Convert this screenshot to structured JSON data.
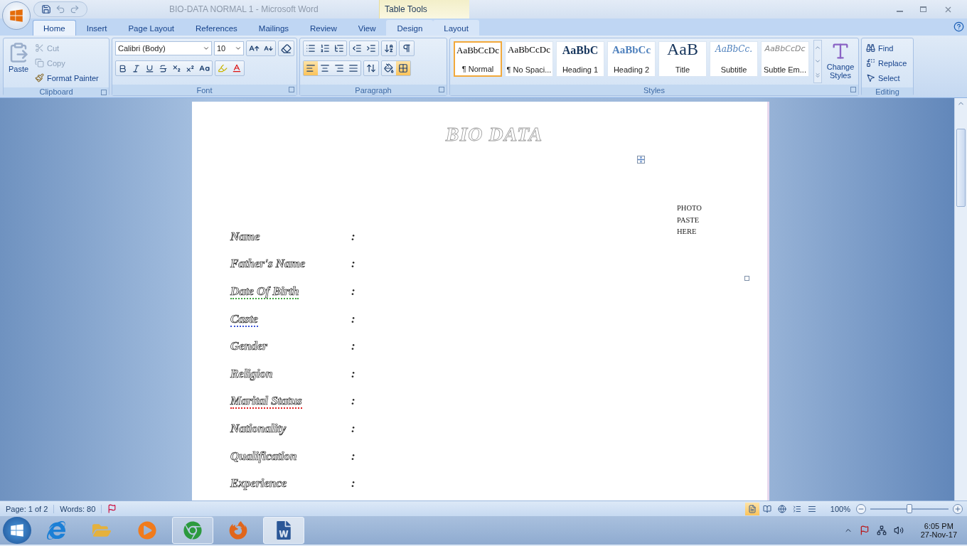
{
  "window": {
    "title": "BIO-DATA NORMAL 1 - Microsoft Word",
    "context_label": "Table Tools"
  },
  "tabs": [
    {
      "label": "Home",
      "selected": true,
      "kind": "main"
    },
    {
      "label": "Insert",
      "selected": false,
      "kind": "main"
    },
    {
      "label": "Page Layout",
      "selected": false,
      "kind": "main"
    },
    {
      "label": "References",
      "selected": false,
      "kind": "main"
    },
    {
      "label": "Mailings",
      "selected": false,
      "kind": "main"
    },
    {
      "label": "Review",
      "selected": false,
      "kind": "main"
    },
    {
      "label": "View",
      "selected": false,
      "kind": "main"
    },
    {
      "label": "Design",
      "selected": false,
      "kind": "contextual"
    },
    {
      "label": "Layout",
      "selected": false,
      "kind": "contextual"
    }
  ],
  "clipboard": {
    "title": "Clipboard",
    "paste": "Paste",
    "commands": [
      {
        "label": "Cut",
        "kind": "cut",
        "disabled": true
      },
      {
        "label": "Copy",
        "kind": "copy",
        "disabled": true
      },
      {
        "label": "Format Painter",
        "kind": "painter",
        "disabled": false
      }
    ]
  },
  "font": {
    "title": "Font",
    "name": "Calibri (Body)",
    "size": "10"
  },
  "paragraph": {
    "title": "Paragraph",
    "alignments": [
      {
        "kind": "left",
        "selected": true
      },
      {
        "kind": "center",
        "selected": false
      },
      {
        "kind": "right",
        "selected": false
      },
      {
        "kind": "justify",
        "selected": false
      }
    ],
    "show_marks": {
      "selected": false
    }
  },
  "styles": {
    "title": "Styles",
    "change": "Change Styles",
    "items": [
      {
        "preview": "AaBbCcDc",
        "label": "¶ Normal",
        "kind": "normal",
        "selected": true
      },
      {
        "preview": "AaBbCcDc",
        "label": "¶ No Spaci...",
        "kind": "normal",
        "selected": false
      },
      {
        "preview": "AaBbC",
        "label": "Heading 1",
        "kind": "heading1",
        "selected": false
      },
      {
        "preview": "AaBbCc",
        "label": "Heading 2",
        "kind": "heading2",
        "selected": false
      },
      {
        "preview": "AaB",
        "label": "Title",
        "kind": "title",
        "selected": false
      },
      {
        "preview": "AaBbCc.",
        "label": "Subtitle",
        "kind": "subtitle",
        "selected": false
      },
      {
        "preview": "AaBbCcDc",
        "label": "Subtle Em...",
        "kind": "subtle",
        "selected": false
      }
    ]
  },
  "editing": {
    "title": "Editing",
    "commands": [
      {
        "label": "Find",
        "kind": "find"
      },
      {
        "label": "Replace",
        "kind": "replace"
      },
      {
        "label": "Select",
        "kind": "select"
      }
    ]
  },
  "document": {
    "title": "BIO DATA",
    "photo_note": [
      "PHOTO",
      "PASTE",
      "HERE"
    ],
    "fields": [
      {
        "label": "Name",
        "separator": ":"
      },
      {
        "label": "Father's Name",
        "separator": ":"
      },
      {
        "label": "Date Of Birth",
        "separator": ":",
        "color": "#3fa33f"
      },
      {
        "label": "Caste",
        "separator": ":",
        "color": "#3a55d6"
      },
      {
        "label": "Gender",
        "separator": ":"
      },
      {
        "label": "Religion",
        "separator": ":"
      },
      {
        "label": "Marital Status",
        "separator": ":",
        "color": "#e02020"
      },
      {
        "label": "Nationality",
        "separator": ":"
      },
      {
        "label": "Qualification",
        "separator": ":"
      },
      {
        "label": "Experience",
        "separator": ":"
      }
    ]
  },
  "status_bar": {
    "page": "Page: 1 of 2",
    "words": "Words: 80",
    "zoom": "100%",
    "zoom_slider": {
      "level": 0.5
    },
    "views": [
      {
        "kind": "print",
        "selected": true
      },
      {
        "kind": "reading",
        "selected": false
      },
      {
        "kind": "web",
        "selected": false
      },
      {
        "kind": "outline",
        "selected": false
      },
      {
        "kind": "draft",
        "selected": false
      }
    ]
  },
  "taskbar": {
    "apps": [
      {
        "kind": "ie",
        "running": false,
        "selected": false
      },
      {
        "kind": "folder",
        "running": false,
        "selected": false
      },
      {
        "kind": "media",
        "running": false,
        "selected": false
      },
      {
        "kind": "chrome",
        "running": true,
        "selected": false
      },
      {
        "kind": "firefox",
        "running": false,
        "selected": false
      },
      {
        "kind": "word",
        "running": true,
        "selected": true
      }
    ],
    "clock": {
      "time": "6:05 PM",
      "date": "27-Nov-17"
    }
  }
}
